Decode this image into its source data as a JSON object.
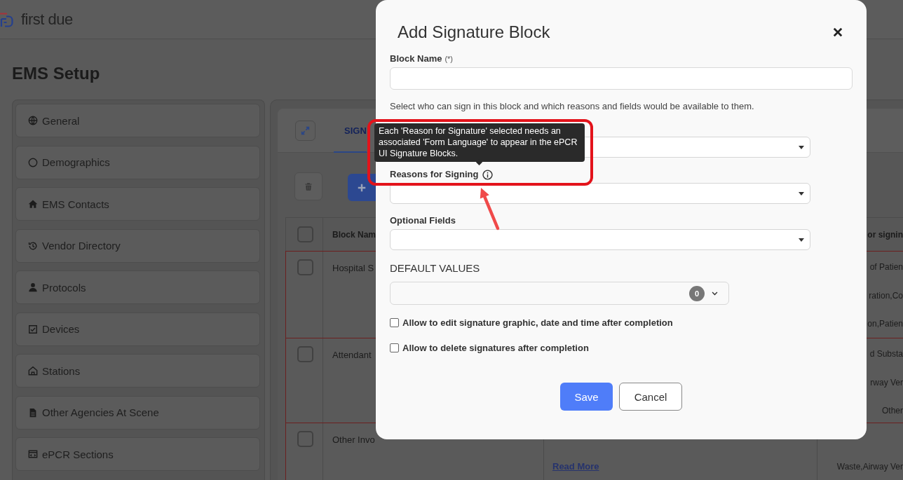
{
  "header": {
    "logo_text": "first due"
  },
  "page_title": "EMS Setup",
  "sidebar": {
    "items": [
      {
        "label": "General"
      },
      {
        "label": "Demographics"
      },
      {
        "label": "EMS Contacts"
      },
      {
        "label": "Vendor Directory"
      },
      {
        "label": "Protocols"
      },
      {
        "label": "Devices"
      },
      {
        "label": "Stations"
      },
      {
        "label": "Other Agencies At Scene"
      },
      {
        "label": "ePCR Sections"
      }
    ]
  },
  "main": {
    "tabs": [
      {
        "label": "SIGN",
        "selected": true
      }
    ],
    "table": {
      "header_checked": false,
      "columns": {
        "column_1": "Block Nam",
        "column_3": "or signin"
      },
      "rows": [
        {
          "checked": false,
          "column_1": "Hospital S",
          "column_3": [
            "of Patien",
            "ration,Co",
            "on,Patien"
          ]
        },
        {
          "checked": false,
          "column_1": "Attendant",
          "column_3": [
            "d Substa",
            "rway Ver",
            "Other"
          ]
        },
        {
          "checked": false,
          "column_1": "Other Invo",
          "column_2_link": "Read More",
          "column_3": [
            "Waste,Airway Ver"
          ]
        }
      ]
    }
  },
  "modal": {
    "title": "Add Signature Block",
    "block_name": {
      "label": "Block Name",
      "required_mark": "(*)"
    },
    "description": "Select who can sign in this block and which reasons and fields would be available to them.",
    "selects": [
      {
        "info": false
      },
      {
        "label": "Reasons for Signing",
        "info": true
      },
      {
        "label": "Optional Fields",
        "info": false
      }
    ],
    "tooltip": "Each 'Reason for Signature' selected needs an associated 'Form Language' to appear in the ePCR UI Signature Blocks.",
    "default_values": {
      "heading": "DEFAULT VALUES",
      "count": "0"
    },
    "checkboxes": [
      {
        "label": "Allow to edit signature graphic, date and time after completion",
        "checked": false
      },
      {
        "label": "Allow to delete signatures after completion",
        "checked": false
      }
    ],
    "buttons": [
      {
        "label": "Save",
        "kind": "primary"
      },
      {
        "label": "Cancel",
        "kind": "secondary"
      }
    ]
  }
}
